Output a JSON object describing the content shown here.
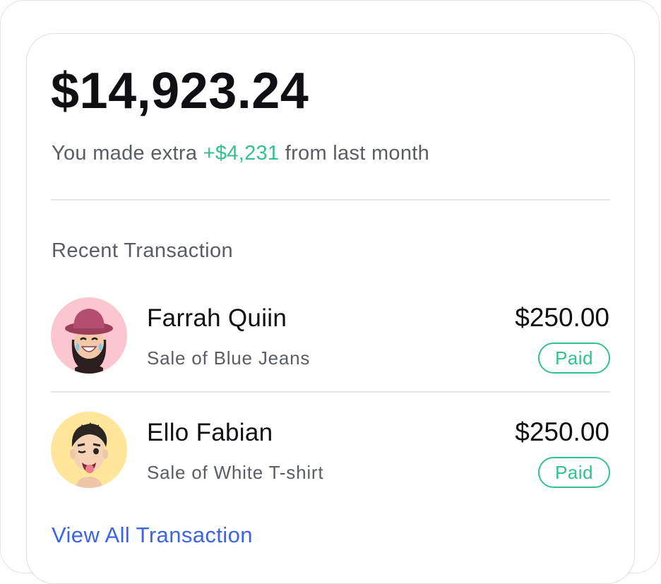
{
  "summary": {
    "balance": "$14,923.24",
    "subtitle_before": "You made extra ",
    "subtitle_extra": "+$4,231",
    "subtitle_after": " from last month"
  },
  "recent": {
    "title": "Recent Transaction",
    "transactions": [
      {
        "name": "Farrah Quiin",
        "description": "Sale of Blue Jeans",
        "amount": "$250.00",
        "status": "Paid",
        "avatar_bg": "#fcc6d0"
      },
      {
        "name": "Ello Fabian",
        "description": "Sale of White T-shirt",
        "amount": "$250.00",
        "status": "Paid",
        "avatar_bg": "#ffe69a"
      }
    ],
    "view_all_label": "View All Transaction"
  },
  "colors": {
    "positive": "#34c18b",
    "link": "#3c64e4",
    "text_primary": "#101014",
    "text_secondary": "#5b5d66"
  }
}
